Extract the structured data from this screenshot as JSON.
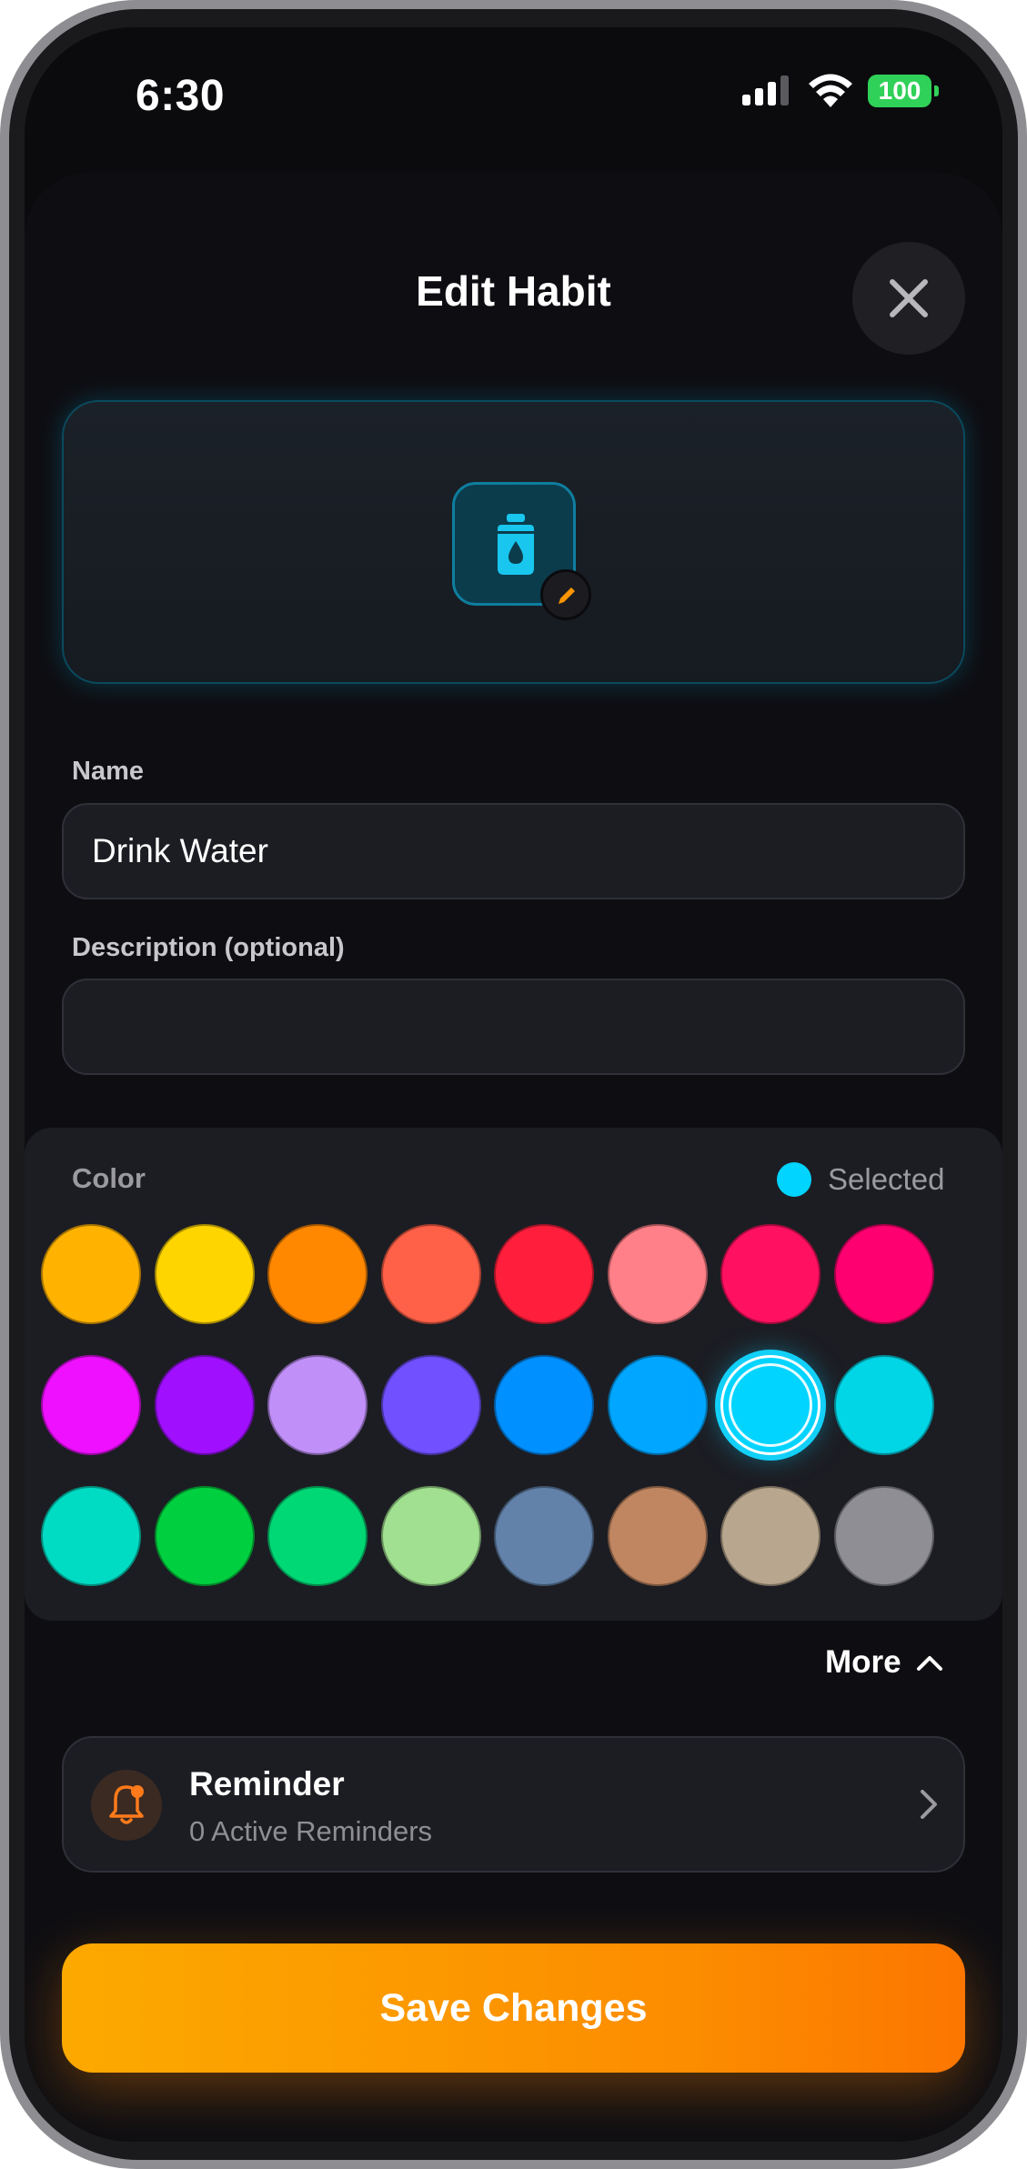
{
  "status_bar": {
    "time": "6:30",
    "battery": "100"
  },
  "sheet": {
    "title": "Edit Habit"
  },
  "preview": {
    "icon": "water-bottle-icon",
    "accent_color": "#12c8f2"
  },
  "form": {
    "name_label": "Name",
    "name_value": "Drink Water",
    "description_label": "Description (optional)",
    "description_value": ""
  },
  "color_picker": {
    "label": "Color",
    "selected_label": "Selected",
    "selected_color": "#00d4ff",
    "swatches": [
      [
        "#ffb300",
        "#ffd500",
        "#ff8800",
        "#ff6048",
        "#ff1f3c",
        "#ff8088",
        "#ff1060",
        "#ff0070"
      ],
      [
        "#ee10ff",
        "#a010ff",
        "#c090f8",
        "#7050ff",
        "#0090ff",
        "#00a6ff",
        "#00d4ff",
        "#00d6e6"
      ],
      [
        "#00dcc4",
        "#00d040",
        "#00d876",
        "#a0e090",
        "#6282aa",
        "#c08662",
        "#b8a68e",
        "#8e8e94"
      ]
    ],
    "selected_row": 1,
    "selected_col": 6
  },
  "more": {
    "label": "More"
  },
  "reminder": {
    "title": "Reminder",
    "subtitle": "0 Active Reminders"
  },
  "save_button": {
    "label": "Save Changes"
  }
}
